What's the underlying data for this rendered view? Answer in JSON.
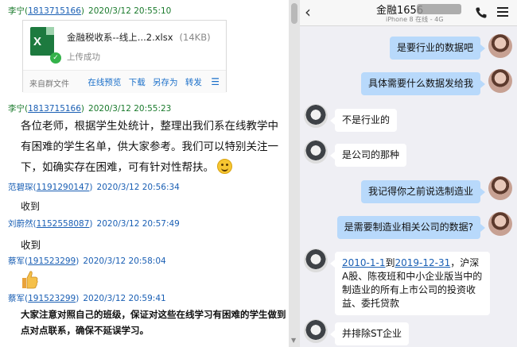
{
  "left_chat": {
    "messages": [
      {
        "sender": "李宁",
        "id": "1813715166",
        "time": "2020/3/12 20:55:10"
      },
      {
        "sender": "李宁",
        "id": "1813715166",
        "time": "2020/3/12 20:55:23"
      },
      {
        "sender": "范碧琛",
        "id": "1191290147",
        "time": "2020/3/12 20:56:34"
      },
      {
        "sender": "刘蔚然",
        "id": "1152558087",
        "time": "2020/3/12 20:57:49"
      },
      {
        "sender": "蔡军",
        "id": "191523299",
        "time": "2020/3/12 20:58:04"
      },
      {
        "sender": "蔡军",
        "id": "191523299",
        "time": "2020/3/12 20:59:41"
      }
    ],
    "file_card": {
      "name": "金融税收系--线上...2.xlsx",
      "size": "(14KB)",
      "status": "上传成功",
      "source": "来自群文件",
      "actions": [
        "在线预览",
        "下载",
        "另存为",
        "转发"
      ]
    },
    "announcement": "各位老师，根据学生处统计，整理出我们系在线教学中有困难的学生名单，供大家参考。我们可以特别关注一下，如确实存在困难，可有针对性帮扶。",
    "reply_1": "收到",
    "reply_2": "收到",
    "final_text": "大家注意对照自己的班级，保证对这些在线学习有困难的学生做到点对点联系，确保不延误学习。"
  },
  "phone": {
    "title": "金融1656",
    "subtitle": "iPhone 8 在线 - 4G",
    "messages": [
      {
        "dir": "out",
        "text": "是要行业的数据吧"
      },
      {
        "dir": "out",
        "text": "具体需要什么数据发给我"
      },
      {
        "dir": "in",
        "text": "不是行业的"
      },
      {
        "dir": "in",
        "text": "是公司的那种"
      },
      {
        "dir": "out",
        "text": "我记得你之前说选制造业"
      },
      {
        "dir": "out",
        "text": "是需要制造业相关公司的数据?"
      },
      {
        "dir": "in",
        "date_from": "2010-1-1",
        "to_word": "到",
        "date_to": "2019-12-31",
        "text": "，沪深A股、陈夜班和中小企业版当中的制造业的所有上市公司的投资收益、委托贷款"
      },
      {
        "dir": "in",
        "text": "并排除ST企业"
      }
    ]
  },
  "colors": {
    "out_bubble": "#b8d9fb",
    "in_bubble": "#ffffff",
    "sender_name": "#1a7a2c",
    "link": "#1a5fb4"
  }
}
